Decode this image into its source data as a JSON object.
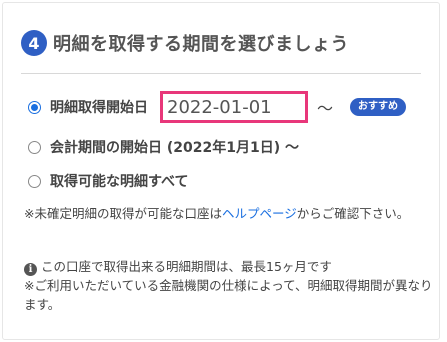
{
  "header": {
    "step_number": "4",
    "title": "明細を取得する期間を選びましょう"
  },
  "options": [
    {
      "label": "明細取得開始日",
      "selected": true
    },
    {
      "label": "会計期間の開始日 (2022年1月1日) 〜",
      "selected": false
    },
    {
      "label": "取得可能な明細すべて",
      "selected": false
    }
  ],
  "date_input": {
    "value": "2022-01-01"
  },
  "tilde": "〜",
  "badge": {
    "recommend_label": "おすすめ"
  },
  "notes": {
    "unconfirmed_prefix": "※未確定明細の取得が可能な口座は",
    "help_link_label": "ヘルプページ",
    "unconfirmed_suffix": "からご確認下さい。",
    "period_info": "この口座で取得出来る明細期間は、最長15ヶ月です",
    "institution_note": "※ご利用いただいている金融機関の仕様によって、明細取得期間が異なります。"
  },
  "colors": {
    "accent_blue": "#2f5fc4",
    "highlight_pink": "#e8377a",
    "link_blue": "#1a6fe0"
  },
  "icons": {
    "info": "info-icon"
  }
}
